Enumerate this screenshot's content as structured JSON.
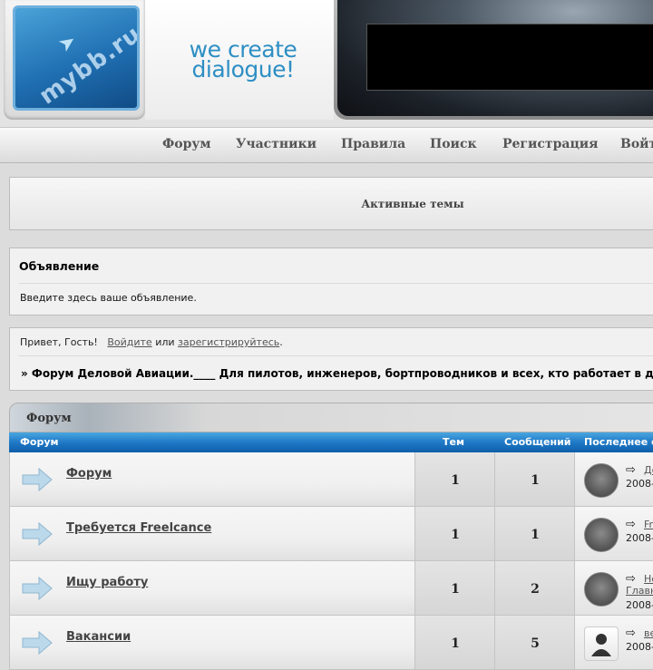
{
  "header": {
    "logo_text": "mybb.ru",
    "slogan_line1": "we create",
    "slogan_line2": "dialogue!"
  },
  "nav": {
    "items": [
      "Форум",
      "Участники",
      "Правила",
      "Поиск",
      "Регистрация",
      "Войти"
    ]
  },
  "active_topics": {
    "label": "Активные темы"
  },
  "announcement": {
    "title": "Объявление",
    "text": "Введите здесь ваше объявление."
  },
  "welcome": {
    "greeting": "Привет, Гость!",
    "login_link": "Войдите",
    "or_text": "или",
    "register_link": "зарегистрируйтесь",
    "period": ".",
    "headline": "» Форум Деловой Авиации.____ Для пилотов, инженеров, бортпроводников и всех, кто работает в д"
  },
  "forum_table": {
    "section_title": "Форум",
    "columns": {
      "forum": "Форум",
      "topics": "Тем",
      "posts": "Сообщений",
      "last": "Последнее с"
    },
    "rows": [
      {
        "name": "Форум",
        "topics": "1",
        "posts": "1",
        "last_link": "Де",
        "last_extra": "",
        "last_date": "2008-",
        "avatar": "avatar-photo"
      },
      {
        "name": "Требуется Freelcance",
        "topics": "1",
        "posts": "1",
        "last_link": "Fr",
        "last_extra": "",
        "last_date": "2008-",
        "avatar": "avatar-photo"
      },
      {
        "name": "Ищу работу",
        "topics": "1",
        "posts": "2",
        "last_link": "Не",
        "last_extra": "Главн",
        "last_date": "2008-",
        "avatar": "avatar-photo"
      },
      {
        "name": "Вакансии",
        "topics": "1",
        "posts": "5",
        "last_link": "ве",
        "last_extra": "",
        "last_date": "2008-",
        "avatar": "avatar-blank"
      }
    ]
  },
  "colors": {
    "accent_blue": "#1f79c6",
    "slogan_blue": "#2e8fc4"
  }
}
